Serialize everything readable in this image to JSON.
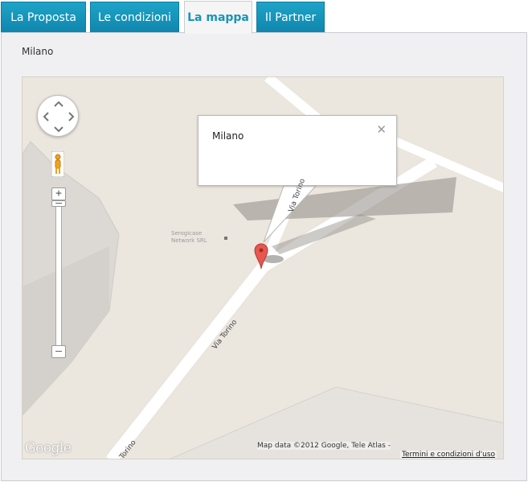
{
  "tabs": [
    {
      "label": "La Proposta",
      "active": false
    },
    {
      "label": "Le condizioni",
      "active": false
    },
    {
      "label": "La mappa",
      "active": true
    },
    {
      "label": "Il Partner",
      "active": false
    }
  ],
  "panel": {
    "location_label": "Milano"
  },
  "map": {
    "info_window_text": "Milano",
    "poi_label": "Serogicase Network SRL",
    "street_labels": [
      "Via Torino",
      "Via Torino",
      "Torino"
    ],
    "attribution": "Map data ©2012 Google, Tele Atlas -",
    "terms_link": "Termini e condizioni d'uso",
    "logo_text": "Google",
    "colors": {
      "tab_bg": "#1799c2",
      "tab_active_text": "#1894b9",
      "map_bg": "#ebe6de",
      "road": "#ffffff",
      "marker": "#e8574f"
    },
    "icons": [
      "pan-control-icon",
      "pegman-icon",
      "zoom-in-icon",
      "zoom-out-icon",
      "close-icon",
      "map-marker-icon"
    ]
  }
}
